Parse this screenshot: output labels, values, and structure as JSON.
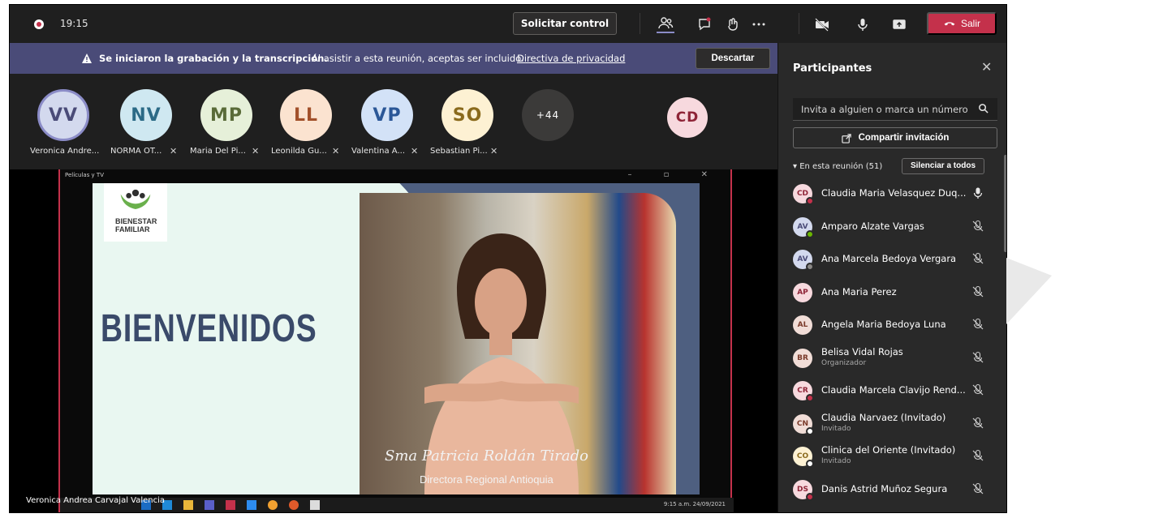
{
  "topbar": {
    "time": "19:15",
    "request_control": "Solicitar control",
    "leave": "Salir"
  },
  "banner": {
    "bold": "Se iniciaron la grabación y la transcripción.",
    "text": "Al asistir a esta reunión, aceptas ser incluido.",
    "link": "Directiva de privacidad",
    "dismiss": "Descartar"
  },
  "avatars": [
    {
      "initials": "VV",
      "label": "Veronica Andre...",
      "bg": "#d3d9ee",
      "fg": "#4a4b78",
      "muted": false
    },
    {
      "initials": "NV",
      "label": "NORMA OT...",
      "bg": "#cfe8f1",
      "fg": "#2b6a86",
      "muted": true
    },
    {
      "initials": "MP",
      "label": "Maria Del Pi...",
      "bg": "#e6f0d9",
      "fg": "#5a6b39",
      "muted": true
    },
    {
      "initials": "LL",
      "label": "Leonilda Gu...",
      "bg": "#fbe3d0",
      "fg": "#a2502a",
      "muted": true
    },
    {
      "initials": "VP",
      "label": "Valentina A...",
      "bg": "#d3e2f7",
      "fg": "#2b5797",
      "muted": true
    },
    {
      "initials": "SO",
      "label": "Sebastian Pi...",
      "bg": "#fdf1d3",
      "fg": "#8a6a1c",
      "muted": true
    },
    {
      "initials": "+44",
      "label": "",
      "bg": "#3b3a39",
      "fg": "#ffffff",
      "muted": false
    }
  ],
  "extra_avatar": {
    "initials": "CD",
    "bg": "#f7d9de",
    "fg": "#8e2437"
  },
  "share": {
    "window_title": "Películas y TV",
    "logo_line1": "BIENESTAR",
    "logo_line2": "FAMILIAR",
    "welcome": "BIENVENIDOS",
    "caption_name": "Sma Patricia Roldán Tirado",
    "caption_role": "Directora Regional Antioquia",
    "tray_time": "9:15 a.m.",
    "tray_date": "24/09/2021"
  },
  "speaker_name": "Veronica Andrea Carvajal Valencia",
  "panel": {
    "title": "Participantes",
    "invite_placeholder": "Invita a alguien o marca un número",
    "share_invite": "Compartir invitación",
    "section": "En esta reunión (51)",
    "mute_all": "Silenciar a todos",
    "participants": [
      {
        "initials": "CD",
        "name": "Claudia Maria Velasquez Duq...",
        "role": "",
        "bg": "#f7d9de",
        "fg": "#8e2437",
        "status": "#c4314b",
        "mic": "on"
      },
      {
        "initials": "AV",
        "name": "Amparo Alzate Vargas",
        "role": "",
        "bg": "#d3d9ee",
        "fg": "#4a4b78",
        "status": "#6bb700",
        "mic": "off"
      },
      {
        "initials": "AV",
        "name": "Ana Marcela Bedoya Vergara",
        "role": "",
        "bg": "#d3d9ee",
        "fg": "#4a4b78",
        "status": "#8a8886",
        "mic": "off"
      },
      {
        "initials": "AP",
        "name": "Ana Maria Perez",
        "role": "",
        "bg": "#f7d9de",
        "fg": "#8e2437",
        "status": "",
        "mic": "off"
      },
      {
        "initials": "AL",
        "name": "Angela Maria Bedoya Luna",
        "role": "",
        "bg": "#f1ddd7",
        "fg": "#7a3a2a",
        "status": "",
        "mic": "off"
      },
      {
        "initials": "BR",
        "name": "Belisa Vidal Rojas",
        "role": "Organizador",
        "bg": "#f1ddd7",
        "fg": "#7a3a2a",
        "status": "",
        "mic": "off"
      },
      {
        "initials": "CR",
        "name": "Claudia Marcela Clavijo Rend...",
        "role": "",
        "bg": "#f7d9de",
        "fg": "#8e2437",
        "status": "#c4314b",
        "mic": "off"
      },
      {
        "initials": "CN",
        "name": "Claudia Narvaez (Invitado)",
        "role": "Invitado",
        "bg": "#f1ddd7",
        "fg": "#7a3a2a",
        "status": "#ffffff",
        "mic": "off"
      },
      {
        "initials": "CO",
        "name": "Clinica del Oriente (Invitado)",
        "role": "Invitado",
        "bg": "#fdf1d3",
        "fg": "#8a6a1c",
        "status": "#ffffff",
        "mic": "off"
      },
      {
        "initials": "DS",
        "name": "Danis Astrid Muñoz Segura",
        "role": "",
        "bg": "#f7d9de",
        "fg": "#8e2437",
        "status": "#c4314b",
        "mic": "off"
      }
    ]
  }
}
